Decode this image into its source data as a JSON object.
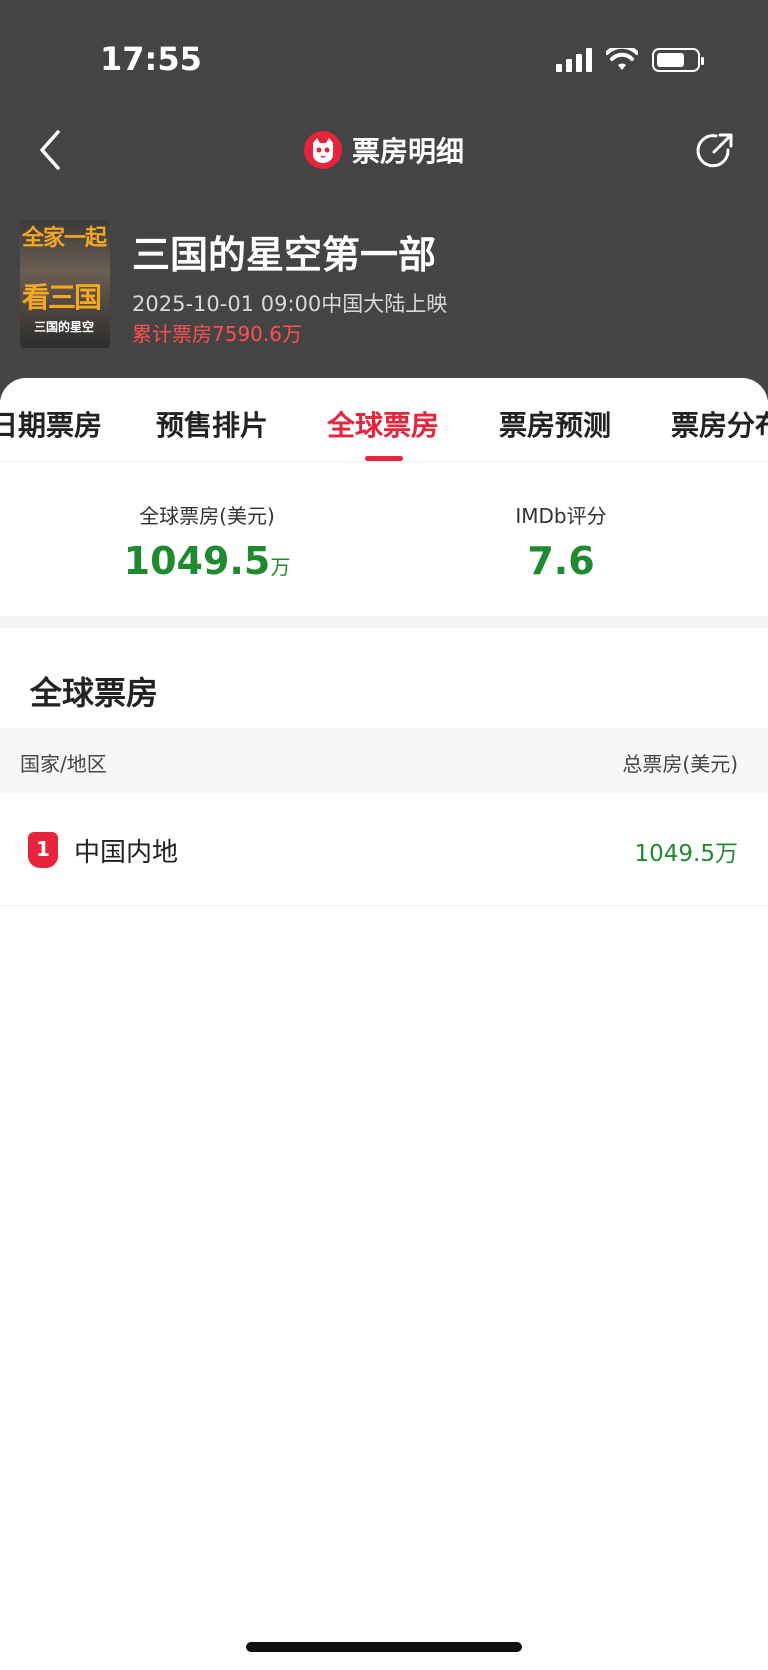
{
  "status_bar": {
    "time": "17:55"
  },
  "nav": {
    "title": "票房明细"
  },
  "movie": {
    "poster_text": {
      "line1": "全家一起",
      "line2": "看三国",
      "line3": "三国的星空"
    },
    "title": "三国的星空第一部",
    "release": "2025-10-01 09:00中国大陆上映",
    "cumulative_box_office": "累计票房7590.6万"
  },
  "tabs": [
    {
      "label": "日期票房",
      "active": false
    },
    {
      "label": "预售排片",
      "active": false
    },
    {
      "label": "全球票房",
      "active": true
    },
    {
      "label": "票房预测",
      "active": false
    },
    {
      "label": "票房分布",
      "active": false
    }
  ],
  "stats": {
    "global": {
      "label": "全球票房(美元)",
      "value": "1049.5",
      "unit": "万"
    },
    "imdb": {
      "label": "IMDb评分",
      "value": "7.6"
    }
  },
  "global_section": {
    "title": "全球票房",
    "columns": {
      "region": "国家/地区",
      "total": "总票房(美元)"
    },
    "rows": [
      {
        "rank": "1",
        "region": "中国内地",
        "total": "1049.5万"
      }
    ]
  },
  "colors": {
    "accent": "#e8243c",
    "value_green": "#1f8a2f",
    "header_bg": "#444444"
  },
  "icons": [
    "back-arrow-icon",
    "cat-logo-icon",
    "share-icon",
    "signal-icon",
    "wifi-icon",
    "battery-icon"
  ]
}
